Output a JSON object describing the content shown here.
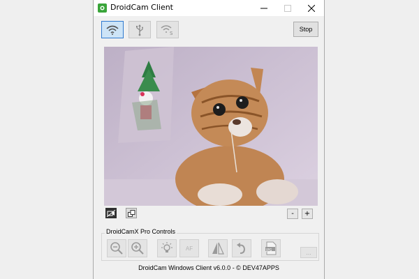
{
  "window": {
    "title": "DroidCam Client"
  },
  "toolbar": {
    "wifi_icon": "wifi-icon",
    "usb_icon": "usb-icon",
    "wifi_server_icon": "wifi-server-icon",
    "stop_label": "Stop"
  },
  "video": {
    "controls": {
      "minus_label": "-",
      "plus_label": "+"
    }
  },
  "pro_controls": {
    "label": "DroidCamX Pro Controls",
    "af_label": "AF",
    "jpg_label": "JPG",
    "more_label": "..."
  },
  "footer": {
    "text": "DroidCam Windows Client v6.0.0 - © DEV47APPS"
  },
  "colors": {
    "active_border": "#2f7ad0",
    "active_bg": "#cde4f7",
    "app_icon_green": "#3aa53a"
  }
}
